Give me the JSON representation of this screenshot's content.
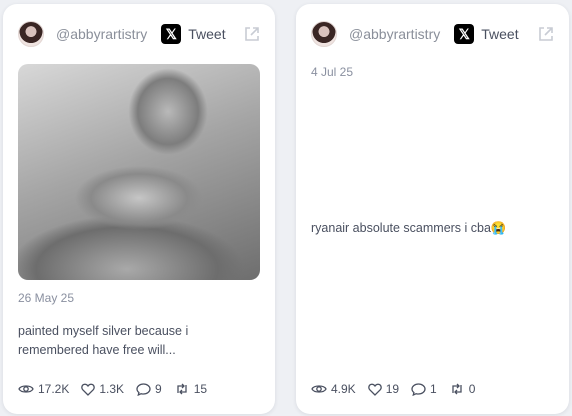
{
  "cards": [
    {
      "handle": "@abbyrartistry",
      "tweet_label": "Tweet",
      "date": "26 May 25",
      "text_line1": "painted myself silver because i",
      "text_line2": "remembered have free will...",
      "stats": {
        "views": "17.2K",
        "likes": "1.3K",
        "replies": "9",
        "retweets": "15"
      }
    },
    {
      "handle": "@abbyrartistry",
      "tweet_label": "Tweet",
      "date": "4 Jul 25",
      "text": "ryanair absolute scammers i cba😭",
      "stats": {
        "views": "4.9K",
        "likes": "19",
        "replies": "1",
        "retweets": "0"
      }
    }
  ],
  "icons": {
    "x_logo": "x-logo-icon",
    "external": "external-link-icon",
    "views": "eye-icon",
    "likes": "heart-icon",
    "replies": "comment-icon",
    "retweets": "retweet-icon"
  }
}
